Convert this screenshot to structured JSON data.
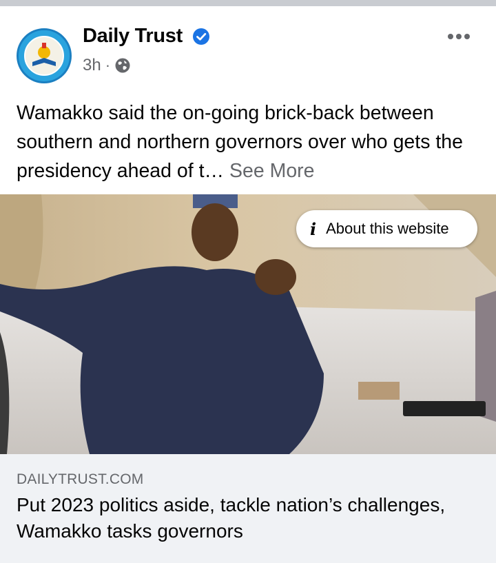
{
  "post": {
    "author": "Daily Trust",
    "timestamp": "3h",
    "separator": "·",
    "text": "Wamakko said the on-going brick-back between southern and northern governors over who gets the presidency ahead of t…",
    "see_more": "See More",
    "verified": true,
    "audience_icon": "globe-icon",
    "options_icon": "more-horizontal-icon"
  },
  "image": {
    "about_label": "About this website",
    "about_icon": "info-icon"
  },
  "link_preview": {
    "domain": "DAILYTRUST.COM",
    "title": "Put 2023 politics aside, tackle nation’s challenges, Wamakko tasks governors"
  },
  "colors": {
    "verified_blue": "#1b74e4",
    "secondary_text": "#65676b",
    "preview_bg": "#f0f2f5"
  }
}
